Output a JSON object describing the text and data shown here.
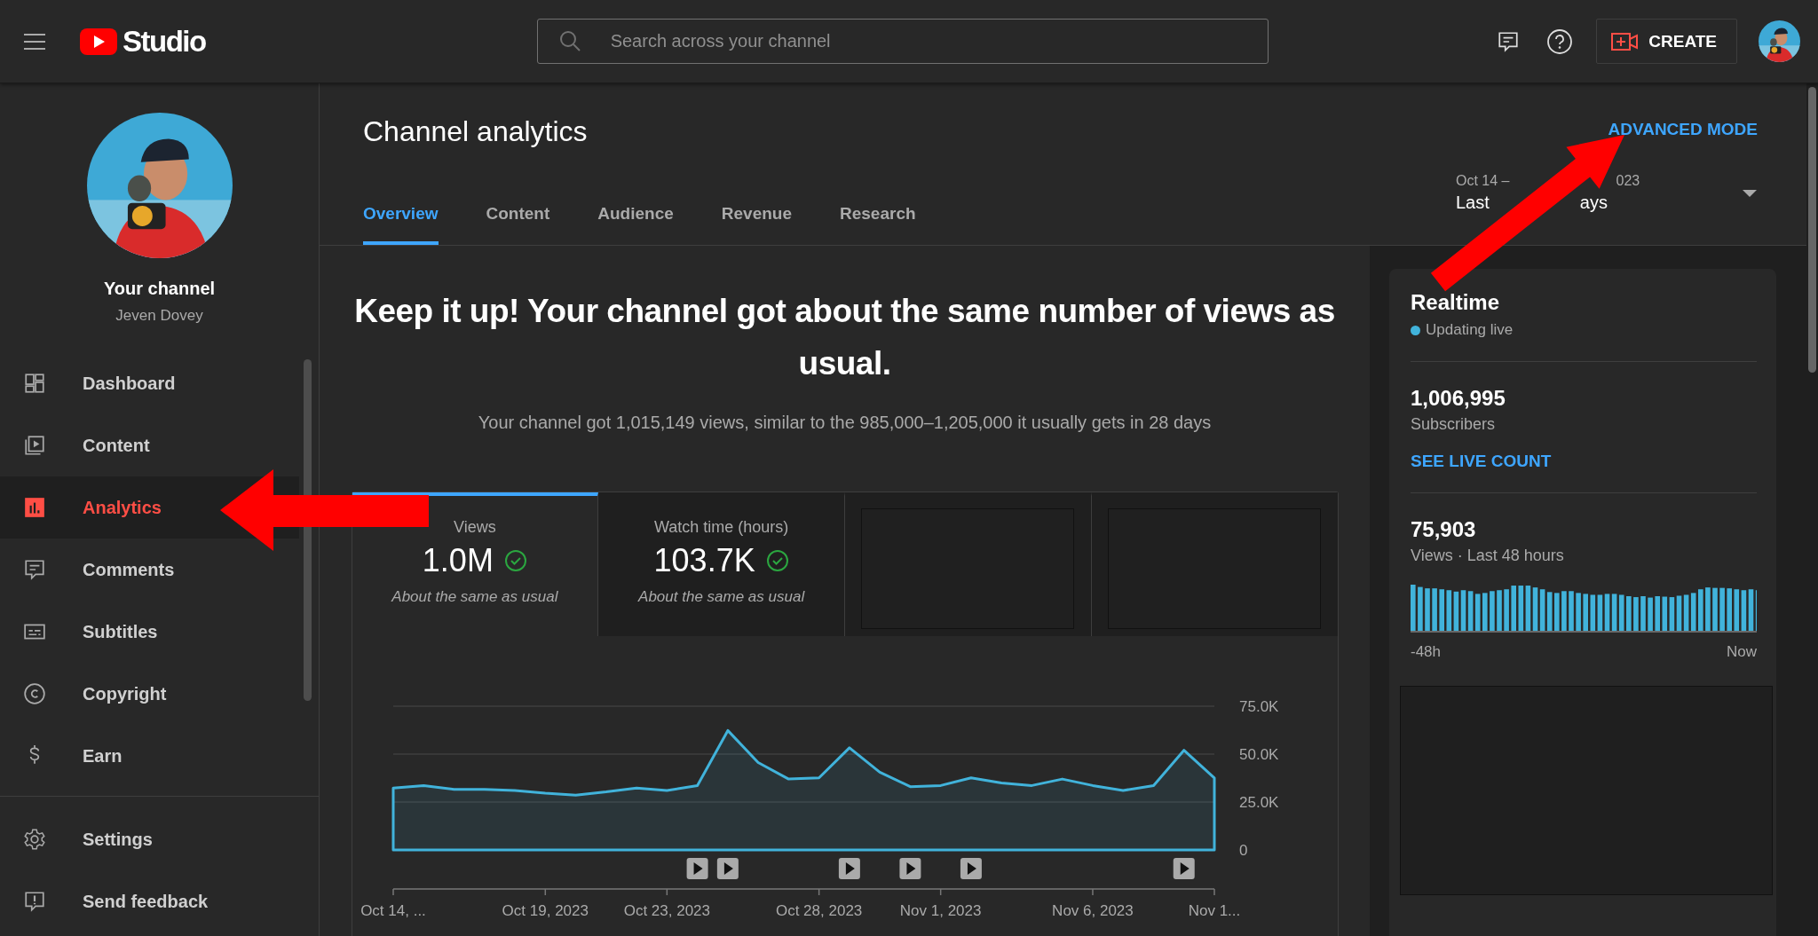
{
  "header": {
    "app_name": "Studio",
    "search": {
      "placeholder": "Search across your channel"
    },
    "create_button": "CREATE"
  },
  "sidebar": {
    "channel_title": "Your channel",
    "channel_name": "Jeven Dovey",
    "items": [
      {
        "label": "Dashboard",
        "selected": false
      },
      {
        "label": "Content",
        "selected": false
      },
      {
        "label": "Analytics",
        "selected": true
      },
      {
        "label": "Comments",
        "selected": false
      },
      {
        "label": "Subtitles",
        "selected": false
      },
      {
        "label": "Copyright",
        "selected": false
      },
      {
        "label": "Earn",
        "selected": false
      }
    ],
    "footer_items": [
      {
        "label": "Settings"
      },
      {
        "label": "Send feedback"
      }
    ]
  },
  "page": {
    "title": "Channel analytics",
    "advanced_mode": "ADVANCED MODE",
    "tabs": [
      {
        "label": "Overview",
        "selected": true
      },
      {
        "label": "Content",
        "selected": false
      },
      {
        "label": "Audience",
        "selected": false
      },
      {
        "label": "Revenue",
        "selected": false
      },
      {
        "label": "Research",
        "selected": false
      }
    ],
    "date_range": {
      "period_start": "Oct 14 –",
      "period_end": "023",
      "preset_start": "Last",
      "preset_end": "ays"
    }
  },
  "summary": {
    "headline": "Keep it up! Your channel got about the same number of views as usual.",
    "detail": "Your channel got 1,015,149 views, similar to the 985,000–1,205,000 it usually gets in 28 days"
  },
  "metric_cards": [
    {
      "kind": "metric",
      "label": "Views",
      "value": "1.0M",
      "note": "About the same as usual",
      "selected": true
    },
    {
      "kind": "metric",
      "label": "Watch time (hours)",
      "value": "103.7K",
      "note": "About the same as usual",
      "selected": false
    },
    {
      "kind": "loading",
      "selected": false
    },
    {
      "kind": "loading",
      "selected": false
    }
  ],
  "chart": {
    "chart_data": {
      "type": "area",
      "categories": [
        "Oct 14, ...",
        null,
        null,
        null,
        null,
        "Oct 19, 2023",
        null,
        null,
        null,
        "Oct 23, 2023",
        null,
        null,
        null,
        null,
        "Oct 28, 2023",
        null,
        null,
        null,
        "Nov 1, 2023",
        null,
        null,
        null,
        null,
        "Nov 6, 2023",
        null,
        null,
        null,
        "Nov 1..."
      ],
      "series": [
        {
          "color": "#41b3db",
          "values": [
            32300,
            33600,
            31600,
            31600,
            31000,
            29600,
            28600,
            30300,
            32300,
            31000,
            33600,
            62300,
            45600,
            37000,
            37600,
            53300,
            40600,
            33000,
            33600,
            37600,
            35000,
            33600,
            37000,
            33600,
            31000,
            33600,
            52000,
            37600
          ]
        }
      ],
      "ylim": [
        0,
        75000
      ],
      "yticks": [
        {
          "value": 0,
          "label": "0"
        },
        {
          "value": 25000,
          "label": "25.0K"
        },
        {
          "value": 50000,
          "label": "50.0K"
        },
        {
          "value": 75000,
          "label": "75.0K"
        }
      ]
    },
    "video_uploads": [
      false,
      false,
      false,
      false,
      false,
      false,
      false,
      false,
      false,
      false,
      true,
      true,
      false,
      false,
      false,
      true,
      false,
      true,
      false,
      true,
      false,
      false,
      false,
      false,
      false,
      false,
      true,
      false
    ]
  },
  "realtime": {
    "title": "Realtime",
    "status": "Updating live",
    "subscribers": "1,006,995",
    "subscribers_label": "Subscribers",
    "live_count_link": "SEE LIVE COUNT",
    "views": "75,903",
    "views_label": "Views · Last 48 hours",
    "axis_start": "-48h",
    "axis_end": "Now"
  }
}
